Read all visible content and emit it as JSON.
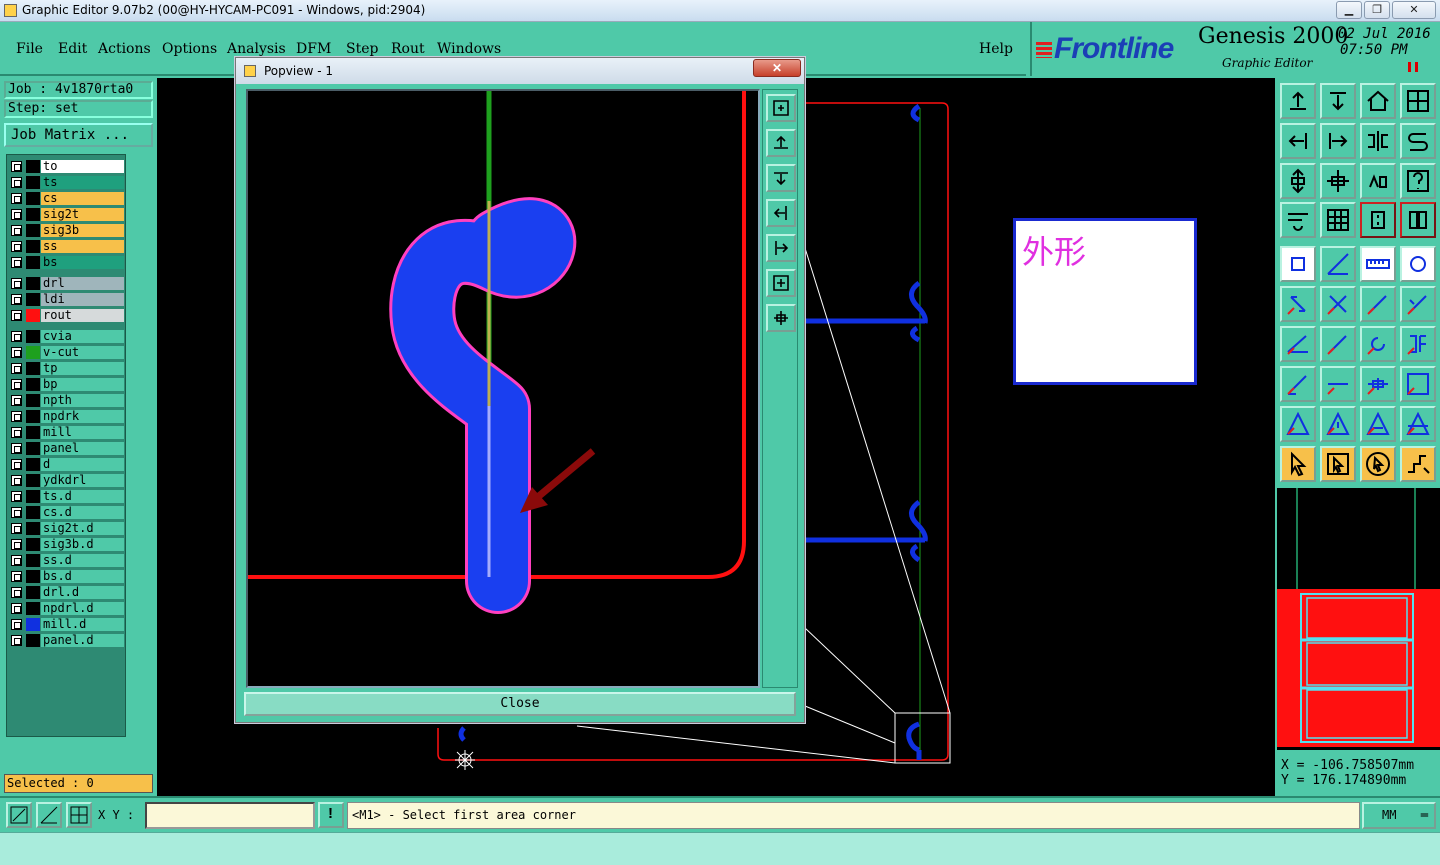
{
  "window": {
    "title": "Graphic Editor 9.07b2 (00@HY-HYCAM-PC091 - Windows, pid:2904)",
    "minimize_icon": "minimize-icon",
    "restore_icon": "restore-icon",
    "close_icon": "close-icon"
  },
  "menu": {
    "items": [
      "File",
      "Edit",
      "Actions",
      "Options",
      "Analysis",
      "DFM",
      "Step",
      "Rout",
      "Windows"
    ],
    "help": "Help"
  },
  "branding": {
    "brand": "Frontline",
    "product": "Genesis 2000",
    "subtitle": "Graphic Editor",
    "date": "02 Jul 2016",
    "time": "07:50 PM"
  },
  "job": {
    "job_line": "Job : 4v1870rta0",
    "step_line": "Step: set",
    "matrix_button": "Job Matrix ..."
  },
  "layers": [
    {
      "name": "to",
      "bg": "#ffffff",
      "swatch": "#000000"
    },
    {
      "name": "ts",
      "bg": "#1fa07e",
      "swatch": "#000000"
    },
    {
      "name": "cs",
      "bg": "#f7c04a",
      "swatch": "#000000"
    },
    {
      "name": "sig2t",
      "bg": "#f7c04a",
      "swatch": "#000000"
    },
    {
      "name": "sig3b",
      "bg": "#f7c04a",
      "swatch": "#000000"
    },
    {
      "name": "ss",
      "bg": "#f7c04a",
      "swatch": "#000000"
    },
    {
      "name": "bs",
      "bg": "#1fa07e",
      "swatch": "#000000"
    },
    {
      "name": "drl",
      "bg": "#9fb5bb",
      "swatch": "#000000"
    },
    {
      "name": "ldi",
      "bg": "#9fb5bb",
      "swatch": "#000000"
    },
    {
      "name": "rout",
      "bg": "#d6dadb",
      "swatch": "#ff1010"
    },
    {
      "name": "cvia",
      "bg": "#4fc9a8",
      "swatch": "#000000"
    },
    {
      "name": "v-cut",
      "bg": "#4fc9a8",
      "swatch": "#1ea01e"
    },
    {
      "name": "tp",
      "bg": "#4fc9a8",
      "swatch": "#000000"
    },
    {
      "name": "bp",
      "bg": "#4fc9a8",
      "swatch": "#000000"
    },
    {
      "name": "npth",
      "bg": "#4fc9a8",
      "swatch": "#000000"
    },
    {
      "name": "npdrk",
      "bg": "#4fc9a8",
      "swatch": "#000000"
    },
    {
      "name": "mill",
      "bg": "#4fc9a8",
      "swatch": "#000000"
    },
    {
      "name": "panel",
      "bg": "#4fc9a8",
      "swatch": "#000000"
    },
    {
      "name": "d",
      "bg": "#4fc9a8",
      "swatch": "#000000"
    },
    {
      "name": "ydkdrl",
      "bg": "#4fc9a8",
      "swatch": "#000000"
    },
    {
      "name": "ts.d",
      "bg": "#4fc9a8",
      "swatch": "#000000"
    },
    {
      "name": "cs.d",
      "bg": "#4fc9a8",
      "swatch": "#000000"
    },
    {
      "name": "sig2t.d",
      "bg": "#4fc9a8",
      "swatch": "#000000"
    },
    {
      "name": "sig3b.d",
      "bg": "#4fc9a8",
      "swatch": "#000000"
    },
    {
      "name": "ss.d",
      "bg": "#4fc9a8",
      "swatch": "#000000"
    },
    {
      "name": "bs.d",
      "bg": "#4fc9a8",
      "swatch": "#000000"
    },
    {
      "name": "drl.d",
      "bg": "#4fc9a8",
      "swatch": "#000000"
    },
    {
      "name": "npdrl.d",
      "bg": "#4fc9a8",
      "swatch": "#000000"
    },
    {
      "name": "mill.d",
      "bg": "#4fc9a8",
      "swatch": "#1030e0"
    },
    {
      "name": "panel.d",
      "bg": "#4fc9a8",
      "swatch": "#000000"
    }
  ],
  "selected": "Selected : 0",
  "canvas": {
    "note_text": "外形"
  },
  "coords": {
    "x": "X  = -106.758507mm",
    "y": "Y  = 176.174890mm"
  },
  "bottom": {
    "xy_label": "X Y :",
    "xy_value": "",
    "prompt": "<M1> - Select first area corner",
    "units": "MM"
  },
  "popview": {
    "title": "Popview - 1",
    "close_label": "Close",
    "title_close": "✕"
  },
  "colors": {
    "panel": "#4fc9a8",
    "rout": "#ff1010",
    "mill": "#1030e0",
    "vcut": "#1ea01e",
    "outline": "#ff40c0"
  }
}
